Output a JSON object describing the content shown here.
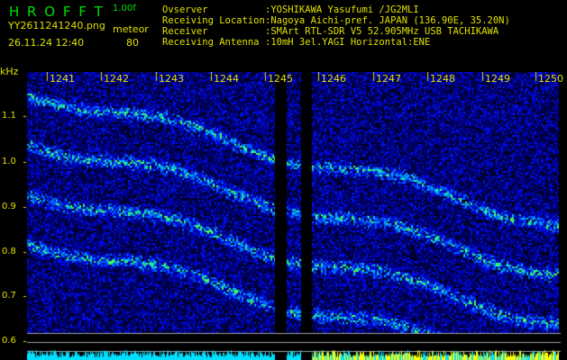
{
  "app": {
    "title": "H R O F F T",
    "version": "1.00f"
  },
  "file": {
    "name": "YY2611241240.png",
    "datetime": "26.11.24 12:40"
  },
  "meteor": {
    "label": "meteor",
    "count": "80"
  },
  "info": [
    {
      "key": "Ovserver",
      "value": ":YOSHIKAWA Yasufumi /JG2MLI"
    },
    {
      "key": "Receiving Location",
      "value": ":Nagoya Aichi-pref. JAPAN (136.90E, 35.20N)"
    },
    {
      "key": "Receiver",
      "value": ":SMArt RTL-SDR V5 52.905MHz USB TACHIKAWA"
    },
    {
      "key": "Receiving Antenna",
      "value": ":10mH 3el.YAGI Horizontal:ENE"
    }
  ],
  "axis": {
    "unit": "kHz",
    "x_labels": [
      "1241",
      "1242",
      "1243",
      "1244",
      "1245",
      "1246",
      "1247",
      "1248",
      "1249",
      "1250"
    ],
    "y_labels": [
      "1.1",
      "1.0",
      "0.9",
      "0.8",
      "0.7",
      "0.6"
    ]
  },
  "colors": {
    "text": "#e0e000",
    "title": "#00e000",
    "bar_left": "#00e0ff",
    "bar_right": "#ffff00"
  }
}
